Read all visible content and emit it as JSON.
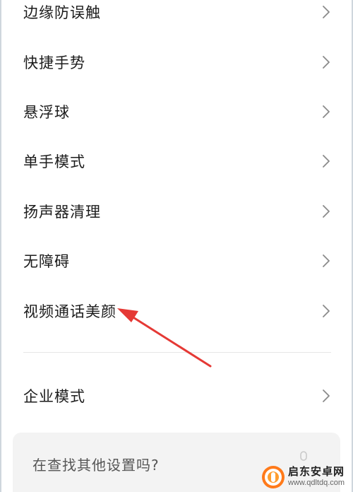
{
  "settings_list": {
    "items": [
      {
        "label": "边缘防误触",
        "icon": "chevron-right-icon"
      },
      {
        "label": "快捷手势",
        "icon": "chevron-right-icon"
      },
      {
        "label": "悬浮球",
        "icon": "chevron-right-icon"
      },
      {
        "label": "单手模式",
        "icon": "chevron-right-icon"
      },
      {
        "label": "扬声器清理",
        "icon": "chevron-right-icon"
      },
      {
        "label": "无障碍",
        "icon": "chevron-right-icon"
      },
      {
        "label": "视频通话美颜",
        "icon": "chevron-right-icon"
      }
    ],
    "enterprise": {
      "label": "企业模式",
      "icon": "chevron-right-icon"
    }
  },
  "search_card": {
    "prompt": "在查找其他设置吗?"
  },
  "watermark": {
    "title": "启东安卓网",
    "url": "www.qdltdq.com"
  },
  "colors": {
    "annotation_arrow": "#e53935",
    "chevron": "#8a8a8a",
    "card_background": "#f3f3f3"
  }
}
